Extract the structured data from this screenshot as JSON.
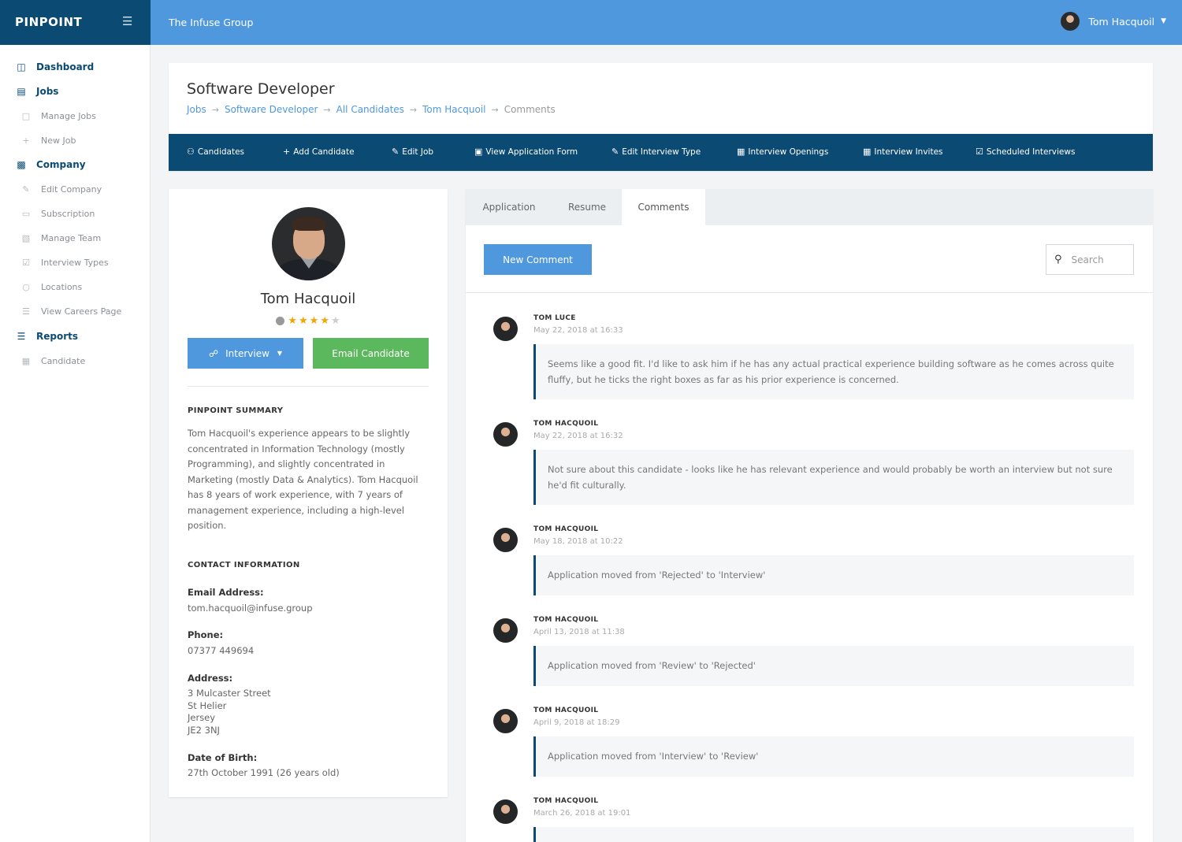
{
  "brand": {
    "name": "PINPOINT",
    "menu_icon": "hamburger-icon"
  },
  "topbar": {
    "org": "The Infuse Group",
    "user": "Tom Hacquoil"
  },
  "sidebar": [
    {
      "label": "Dashboard",
      "icon": "monitor-icon",
      "type": "main"
    },
    {
      "label": "Jobs",
      "icon": "briefcase-icon",
      "type": "main"
    },
    {
      "label": "Manage Jobs",
      "icon": "folder-icon",
      "type": "sub"
    },
    {
      "label": "New Job",
      "icon": "plus-icon",
      "type": "sub"
    },
    {
      "label": "Company",
      "icon": "building-icon",
      "type": "main"
    },
    {
      "label": "Edit Company",
      "icon": "edit-icon",
      "type": "sub"
    },
    {
      "label": "Subscription",
      "icon": "money-icon",
      "type": "sub"
    },
    {
      "label": "Manage Team",
      "icon": "team-icon",
      "type": "sub"
    },
    {
      "label": "Interview Types",
      "icon": "checklist-icon",
      "type": "sub"
    },
    {
      "label": "Locations",
      "icon": "map-pin-icon",
      "type": "sub"
    },
    {
      "label": "View Careers Page",
      "icon": "list-icon",
      "type": "sub"
    },
    {
      "label": "Reports",
      "icon": "database-icon",
      "type": "main"
    },
    {
      "label": "Candidate",
      "icon": "table-icon",
      "type": "sub"
    }
  ],
  "header": {
    "title": "Software Developer",
    "breadcrumb": [
      "Jobs",
      "Software Developer",
      "All Candidates",
      "Tom Hacquoil",
      "Comments"
    ]
  },
  "job_tabs": [
    {
      "label": "Candidates",
      "icon": "users-icon"
    },
    {
      "label": "Add Candidate",
      "icon": "plus-icon"
    },
    {
      "label": "Edit Job",
      "icon": "edit-icon"
    },
    {
      "label": "View Application Form",
      "icon": "window-icon"
    },
    {
      "label": "Edit Interview Type",
      "icon": "edit-icon"
    },
    {
      "label": "Interview Openings",
      "icon": "calendar-icon"
    },
    {
      "label": "Interview Invites",
      "icon": "calendar-icon"
    },
    {
      "label": "Scheduled Interviews",
      "icon": "calendar-check-icon"
    }
  ],
  "candidate": {
    "name": "Tom Hacquoil",
    "rating": 4,
    "rating_max": 5,
    "stage_button": "Interview",
    "email_button": "Email Candidate",
    "summary_title": "PINPOINT SUMMARY",
    "summary": "Tom Hacquoil's experience appears to be slightly concentrated in Information Technology (mostly Programming), and slightly concentrated in Marketing (mostly Data & Analytics). Tom Hacquoil has 8 years of work experience, with 7 years of management experience, including a high-level position.",
    "contact_title": "CONTACT INFORMATION",
    "email_label": "Email Address:",
    "email": "tom.hacquoil@infuse.group",
    "phone_label": "Phone:",
    "phone": "07377 449694",
    "address_label": "Address:",
    "address": [
      "3 Mulcaster Street",
      "St Helier",
      "Jersey",
      "JE2 3NJ"
    ],
    "dob_label": "Date of Birth:",
    "dob": "27th October 1991 (26 years old)"
  },
  "panel": {
    "tabs": [
      "Application",
      "Resume",
      "Comments"
    ],
    "active_tab": "Comments",
    "new_comment": "New Comment",
    "search_placeholder": "Search"
  },
  "comments": [
    {
      "author": "TOM LUCE",
      "date": "May 22, 2018 at 16:33",
      "text": "Seems like a good fit. I'd like to ask him if he has any actual practical experience building software as he comes across quite fluffy, but he ticks the right boxes as far as his prior experience is concerned."
    },
    {
      "author": "TOM HACQUOIL",
      "date": "May 22, 2018 at 16:32",
      "text": "Not sure about this candidate - looks like he has relevant experience and would probably be worth an interview but not sure he'd fit culturally."
    },
    {
      "author": "TOM HACQUOIL",
      "date": "May 18, 2018 at 10:22",
      "text": "Application moved from 'Rejected' to 'Interview'"
    },
    {
      "author": "TOM HACQUOIL",
      "date": "April 13, 2018 at 11:38",
      "text": "Application moved from 'Review' to 'Rejected'"
    },
    {
      "author": "TOM HACQUOIL",
      "date": "April 9, 2018 at 18:29",
      "text": "Application moved from 'Interview' to 'Review'"
    },
    {
      "author": "TOM HACQUOIL",
      "date": "March 26, 2018 at 19:01",
      "text": ""
    }
  ]
}
